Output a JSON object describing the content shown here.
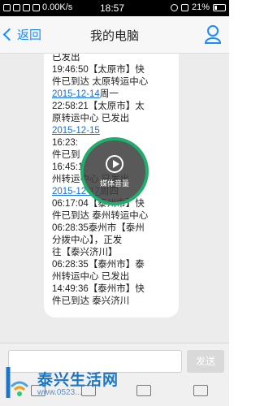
{
  "statusbar": {
    "speed": "0.00K/s",
    "time": "18:57",
    "battery": "21%"
  },
  "header": {
    "back_label": "返回",
    "title": "我的电脑"
  },
  "message": {
    "lines": [
      {
        "text": "已发出",
        "type": "text"
      },
      {
        "text": "19:46:50【太原市】快",
        "type": "text"
      },
      {
        "text": "件已到达 太原转运中心",
        "type": "text"
      },
      {
        "date": "2015-12-14",
        "rest": "周一",
        "type": "date"
      },
      {
        "text": "22:58:21【太原市】太",
        "type": "text"
      },
      {
        "text": "原转运中心 已发出",
        "type": "text"
      },
      {
        "date": "2015-12-15",
        "rest": "",
        "type": "date"
      },
      {
        "text": "16:23:",
        "type": "text"
      },
      {
        "text": "件已到",
        "type": "text"
      },
      {
        "text": "16:45:1",
        "type": "text"
      },
      {
        "text": "州转运中心 已发出",
        "type": "text"
      },
      {
        "date": "2015-12-17",
        "rest": "周四",
        "type": "date"
      },
      {
        "text": "06:17:04【泰州市】快",
        "type": "text"
      },
      {
        "text": "件已到达 泰州转运中心",
        "type": "text"
      },
      {
        "text": "06:28:35泰州市【泰州",
        "type": "text"
      },
      {
        "text": "分拨中心】，正发",
        "type": "text"
      },
      {
        "text": "往【泰兴济川】",
        "type": "text"
      },
      {
        "text": "06:28:35【泰州市】泰",
        "type": "text"
      },
      {
        "text": "州转运中心 已发出",
        "type": "text"
      },
      {
        "text": "14:49:36【泰州市】快",
        "type": "text"
      },
      {
        "text": "件已到达 泰兴济川",
        "type": "text"
      }
    ]
  },
  "media_overlay": {
    "label": "媒体音量"
  },
  "input": {
    "placeholder": "",
    "send_label": "发送"
  },
  "watermark": {
    "title": "泰兴生活网",
    "url": "www.0523..."
  }
}
